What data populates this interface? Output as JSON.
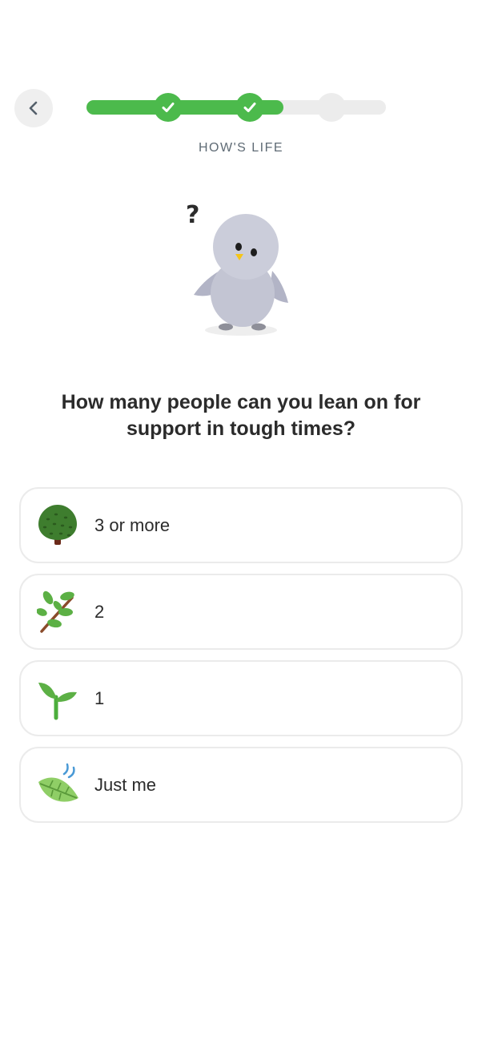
{
  "header": {
    "back_icon": "chevron-left-icon",
    "progress": {
      "completed_steps": 2,
      "total_steps": 3,
      "accent_color": "#4cba4c",
      "track_color": "#ececec"
    },
    "section_label": "HOW'S LIFE"
  },
  "mascot": {
    "icon": "penguin-question-icon",
    "glyph": "?"
  },
  "question": "How many people can you lean on for support in tough times?",
  "options": [
    {
      "label": "3 or more",
      "icon": "tree-icon"
    },
    {
      "label": "2",
      "icon": "branch-icon"
    },
    {
      "label": "1",
      "icon": "sprout-icon"
    },
    {
      "label": "Just me",
      "icon": "leaf-fluttering-icon"
    }
  ]
}
